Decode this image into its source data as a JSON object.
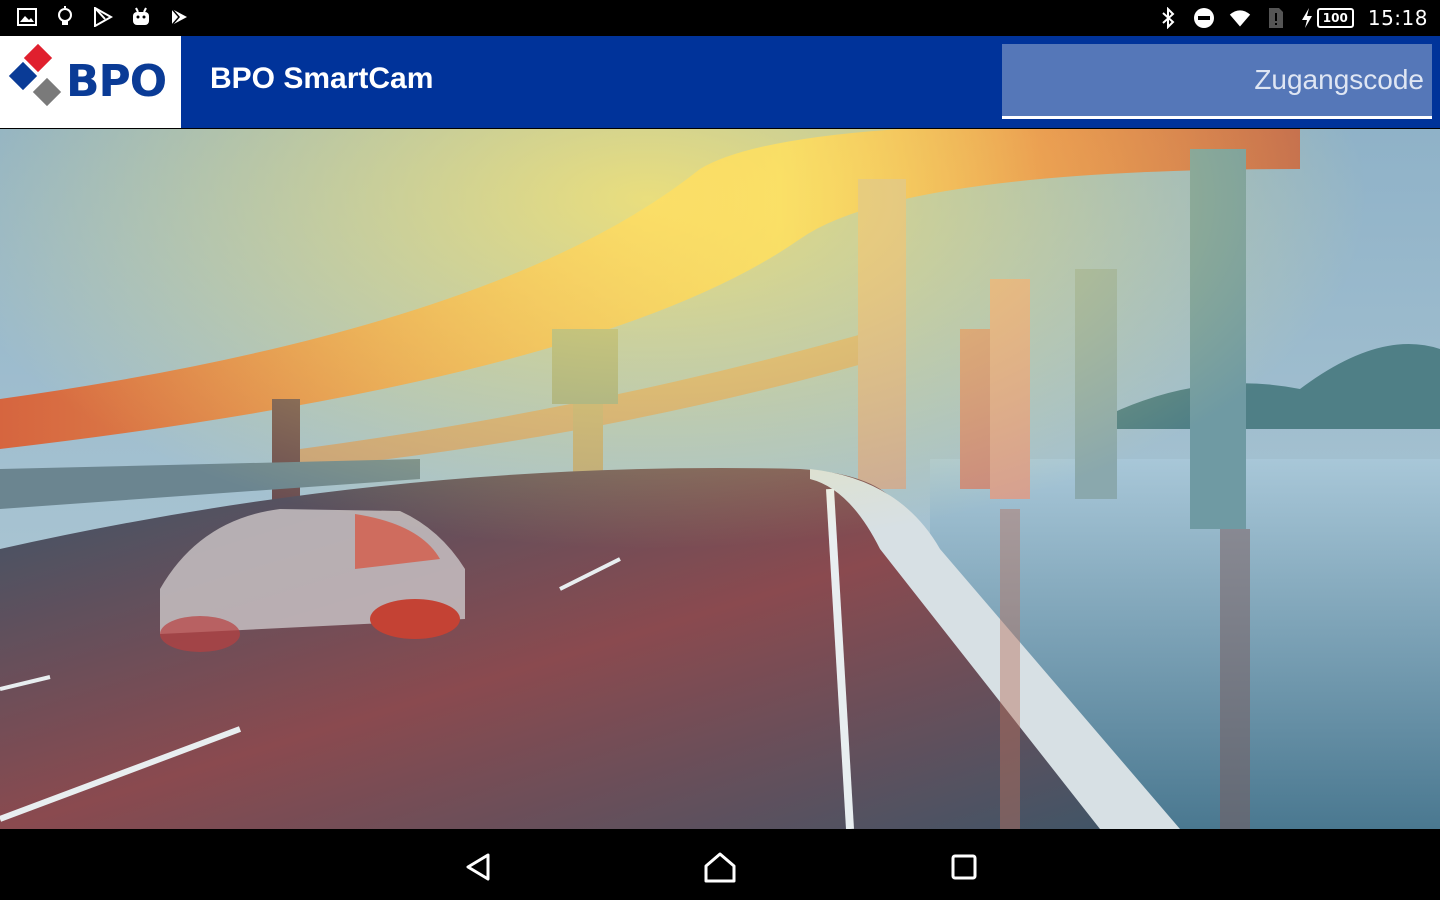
{
  "status_bar": {
    "time": "15:18",
    "battery_level": "100",
    "left_icons": [
      "image-icon",
      "lightbulb-icon",
      "play-store-icon",
      "android-icon",
      "play-icon"
    ],
    "right_icons": [
      "bluetooth-icon",
      "do-not-disturb-icon",
      "wifi-icon",
      "sim-icon",
      "charging-icon"
    ]
  },
  "app_bar": {
    "logo_text": "BPO",
    "title": "BPO SmartCam",
    "access_code_placeholder": "Zugangscode",
    "colors": {
      "bar": "#00339a",
      "field": "#5577b8",
      "logo_red": "#e0202e",
      "logo_blue": "#0a3b96",
      "logo_gray": "#7a7a7a"
    }
  },
  "hero": {
    "image": "highway-interchange-photo"
  },
  "nav_bar": {
    "buttons": [
      "back-icon",
      "home-icon",
      "recents-icon"
    ]
  }
}
